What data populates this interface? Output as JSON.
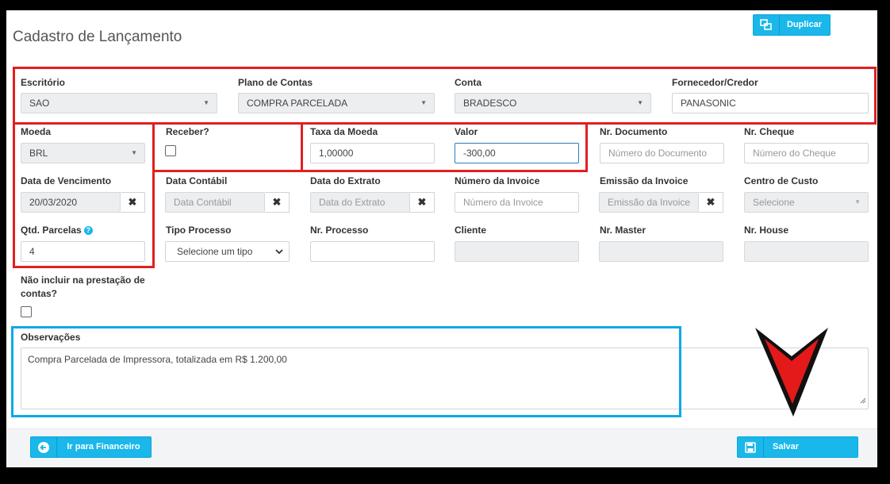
{
  "page": {
    "title": "Cadastro de Lançamento"
  },
  "toolbar": {
    "duplicate_label": "Duplicar"
  },
  "fields": {
    "escritorio": {
      "label": "Escritório",
      "value": "SAO"
    },
    "plano_de_contas": {
      "label": "Plano de Contas",
      "value": "COMPRA PARCELADA"
    },
    "conta": {
      "label": "Conta",
      "value": "BRADESCO"
    },
    "fornecedor": {
      "label": "Fornecedor/Credor",
      "value": "PANASONIC"
    },
    "moeda": {
      "label": "Moeda",
      "value": "BRL"
    },
    "receber": {
      "label": "Receber?",
      "checked": false
    },
    "taxa_moeda": {
      "label": "Taxa da Moeda",
      "value": "1,00000"
    },
    "valor": {
      "label": "Valor",
      "value": "-300,00"
    },
    "nr_documento": {
      "label": "Nr. Documento",
      "placeholder": "Número do Documento"
    },
    "nr_cheque": {
      "label": "Nr. Cheque",
      "placeholder": "Número do Cheque"
    },
    "data_vencimento": {
      "label": "Data de Vencimento",
      "value": "20/03/2020"
    },
    "data_contabil": {
      "label": "Data Contábil",
      "placeholder": "Data Contábil"
    },
    "data_extrato": {
      "label": "Data do Extrato",
      "placeholder": "Data do Extrato"
    },
    "numero_invoice": {
      "label": "Número da Invoice",
      "placeholder": "Número da Invoice"
    },
    "emissao_invoice": {
      "label": "Emissão da Invoice",
      "placeholder": "Emissão da Invoice"
    },
    "centro_custo": {
      "label": "Centro de Custo",
      "placeholder": "Selecione"
    },
    "qtd_parcelas": {
      "label": "Qtd. Parcelas",
      "value": "4"
    },
    "tipo_processo": {
      "label": "Tipo Processo",
      "placeholder": "Selecione um tipo"
    },
    "nr_processo": {
      "label": "Nr. Processo",
      "value": ""
    },
    "cliente": {
      "label": "Cliente",
      "value": ""
    },
    "nr_master": {
      "label": "Nr. Master",
      "value": ""
    },
    "nr_house": {
      "label": "Nr. House",
      "value": ""
    },
    "nao_incluir": {
      "label_line1": "Não incluir na prestação de",
      "label_line2": "contas?",
      "checked": false
    },
    "observacoes": {
      "label": "Observações",
      "value": "Compra Parcelada de Impressora, totalizada em R$ 1.200,00"
    }
  },
  "footer": {
    "financeiro_label": "Ir para Financeiro",
    "save_label": "Salvar"
  },
  "annotations": {
    "highlight_color": "#e02020",
    "observacoes_highlight_color": "#0ea8e8",
    "accent": "#1ab7ea"
  },
  "icons": [
    "duplicate-icon",
    "arrow-left-icon",
    "save-icon",
    "clear-icon",
    "help-icon",
    "caret-down-icon",
    "arrow-down-icon"
  ]
}
